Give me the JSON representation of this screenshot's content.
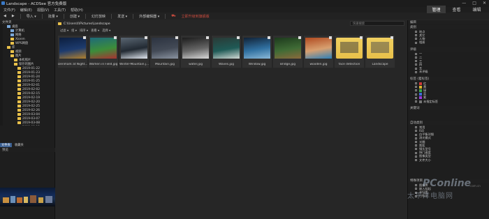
{
  "window": {
    "title": "Landscape - ACDSee 官方免费版",
    "controls": [
      "—",
      "□",
      "✕"
    ]
  },
  "menu": [
    "文件(F)",
    "编辑(E)",
    "视图(V)",
    "工具(T)",
    "帮助(H)"
  ],
  "toolbar": {
    "items": [
      "导入 ▾",
      "批量 ▾",
      "创建 ▾",
      "幻灯放映",
      "发送 ▾",
      "外部编辑器 ▾"
    ],
    "promo": "立即升级到旗舰版"
  },
  "modes": [
    "管理",
    "查看",
    "编辑"
  ],
  "left": {
    "header": "文件夹",
    "tree": [
      {
        "label": "桌面",
        "indent": 1,
        "kind": "pc"
      },
      {
        "label": "计算机",
        "indent": 2,
        "kind": "pc"
      },
      {
        "label": "网络",
        "indent": 2,
        "kind": "pc"
      },
      {
        "label": "Xionm",
        "indent": 2,
        "kind": "folder"
      },
      {
        "label": "WPS网盘",
        "indent": 2,
        "kind": "folder"
      },
      {
        "label": "库",
        "indent": 1,
        "kind": "folder"
      },
      {
        "label": "视频",
        "indent": 2,
        "kind": "folder"
      },
      {
        "label": "图片",
        "indent": 2,
        "kind": "folder"
      },
      {
        "label": "本机照片",
        "indent": 3,
        "kind": "folder"
      },
      {
        "label": "保存的图片",
        "indent": 3,
        "kind": "folder"
      },
      {
        "label": "2019-01-22",
        "indent": 4,
        "kind": "folder"
      },
      {
        "label": "2019-01-23",
        "indent": 4,
        "kind": "folder"
      },
      {
        "label": "2019-01-24",
        "indent": 4,
        "kind": "folder"
      },
      {
        "label": "2019-01-25",
        "indent": 4,
        "kind": "folder"
      },
      {
        "label": "2019-02-01",
        "indent": 4,
        "kind": "folder"
      },
      {
        "label": "2019-02-02",
        "indent": 4,
        "kind": "folder"
      },
      {
        "label": "2019-02-15",
        "indent": 4,
        "kind": "folder"
      },
      {
        "label": "2019-02-19",
        "indent": 4,
        "kind": "folder"
      },
      {
        "label": "2019-02-20",
        "indent": 4,
        "kind": "folder"
      },
      {
        "label": "2019-02-25",
        "indent": 4,
        "kind": "folder"
      },
      {
        "label": "2019-02-26",
        "indent": 4,
        "kind": "folder"
      },
      {
        "label": "2019-03-04",
        "indent": 4,
        "kind": "folder"
      },
      {
        "label": "2019-03-07",
        "indent": 4,
        "kind": "folder"
      },
      {
        "label": "2019-03-08",
        "indent": 4,
        "kind": "folder"
      },
      {
        "label": "2019-03-12",
        "indent": 4,
        "kind": "folder"
      }
    ],
    "tabs": [
      "文件夹",
      "收藏夹"
    ],
    "preview_header": "预览"
  },
  "center": {
    "path": "C:\\Users\\I\\Pictures\\Landscape",
    "search_placeholder": "快速搜索",
    "filters": [
      "过滤 ▾",
      "组 ▾",
      "排序 ▾",
      "查看 ▾",
      "选择 ▾"
    ],
    "thumbnails": [
      {
        "label": "Denmark at Night...",
        "c1": "#0c1e3e",
        "c2": "#1d3b6e",
        "c3": "#b0802e"
      },
      {
        "label": "Women in Field.jpg",
        "c1": "#1e6a7a",
        "c2": "#3c8d3a",
        "c3": "#a83232"
      },
      {
        "label": "Winter-Mountain.j...",
        "c1": "#5a6672",
        "c2": "#222a33",
        "c3": "#e0e6ee"
      },
      {
        "label": "Mountain.jpg",
        "c1": "#2c3340",
        "c2": "#434a56",
        "c3": "#8a93a0"
      },
      {
        "label": "water.jpg",
        "c1": "#1c1c1c",
        "c2": "#656565",
        "c3": "#d8d8d8"
      },
      {
        "label": "Waves.jpg",
        "c1": "#2a3a36",
        "c2": "#1f5a56",
        "c3": "#d0d8d4"
      },
      {
        "label": "Window.jpg",
        "c1": "#112236",
        "c2": "#3070a0",
        "c3": "#8ab8d8"
      },
      {
        "label": "Bridge.jpg",
        "c1": "#1d3a1d",
        "c2": "#3f6b35",
        "c3": "#8a6a3c"
      },
      {
        "label": "wooden.jpg",
        "c1": "#b04a20",
        "c2": "#d8a070",
        "c3": "#2e80b8"
      },
      {
        "label": "face detection",
        "c1": "#e8c04a",
        "c2": "#f0d060",
        "c3": "#3a3a3a"
      },
      {
        "label": "Landscape",
        "c1": "#e8c04a",
        "c2": "#f0d060",
        "c3": "#4a4a4a"
      }
    ]
  },
  "right": {
    "header": "编目",
    "sections": [
      {
        "title": "类别",
        "items": [
          "地点",
          "其它",
          "人物",
          "相册"
        ]
      },
      {
        "title": "评级",
        "items": [
          "一",
          "二",
          "三",
          "四",
          "五",
          "未评级"
        ]
      },
      {
        "title": "标签 (着标签)",
        "items": [
          "红",
          "黄",
          "绿",
          "蓝",
          "紫",
          "未指定标签"
        ]
      },
      {
        "title": "关键词",
        "items": []
      },
      {
        "title": "自动类别",
        "items": [
          "常用",
          "ISO",
          "白平衡详细",
          "测光模式",
          "光圈",
          "焦距",
          "镜头型号",
          "快门速度",
          "图像类型",
          "文件大小"
        ]
      },
      {
        "title": "特殊项目",
        "items": [
          "图像库",
          "嵌入挂起",
          "未归类",
          "已标记"
        ]
      }
    ],
    "label_colors": [
      "#cc3a3a",
      "#d8b42c",
      "#3aa84a",
      "#3a6ed8",
      "#9a3ad8",
      "#777777"
    ]
  },
  "watermark": {
    "brand": "PConline",
    "slogan": "太平洋电脑网",
    "site": ".com.cn"
  }
}
